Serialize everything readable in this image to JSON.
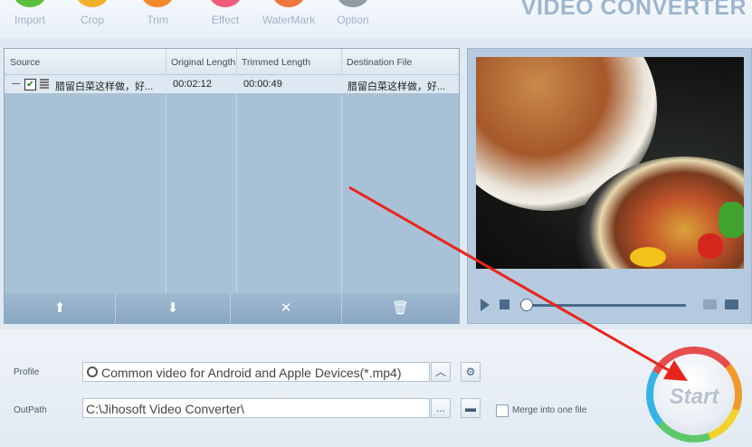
{
  "toolbar": {
    "buttons": [
      {
        "label": "Import",
        "color": "#5bbf3a"
      },
      {
        "label": "Crop",
        "color": "#f2b12a"
      },
      {
        "label": "Trim",
        "color": "#f38a2e"
      },
      {
        "label": "Effect",
        "color": "#ee5e78"
      },
      {
        "label": "WaterMark",
        "color": "#f0773a"
      },
      {
        "label": "Option",
        "color": "#8f9aa5"
      }
    ],
    "brand": "VIDEO CONVERTER"
  },
  "file_table": {
    "columns": [
      "Source",
      "Original Length",
      "Trimmed Length",
      "Destination File"
    ],
    "rows": [
      {
        "checked": true,
        "source": "腊留白菜这样做，好...",
        "original_length": "00:02:12",
        "trimmed_length": "00:00:49",
        "destination": "腊留白菜这样做，好..."
      }
    ],
    "actions": [
      {
        "name": "move-up",
        "icon": "arrow-up-icon"
      },
      {
        "name": "move-down",
        "icon": "arrow-down-icon"
      },
      {
        "name": "remove",
        "icon": "close-icon"
      },
      {
        "name": "clear",
        "icon": "trash-icon"
      }
    ]
  },
  "preview": {
    "icons": [
      "play-icon",
      "stop-icon",
      "camera-icon",
      "folder-icon"
    ],
    "seek_position": 0.0
  },
  "settings": {
    "profile_label": "Profile",
    "profile_value": "Common video for Android and Apple Devices(*.mp4)",
    "outpath_label": "OutPath",
    "outpath_value": "C:\\Jihosoft Video Converter\\",
    "browse_label": "...",
    "merge_label": "Merge into one file",
    "merge_checked": false
  },
  "start": {
    "label": "Start"
  },
  "colors": {
    "annotation_arrow": "#e8251c",
    "brand": "#9db6cf"
  }
}
